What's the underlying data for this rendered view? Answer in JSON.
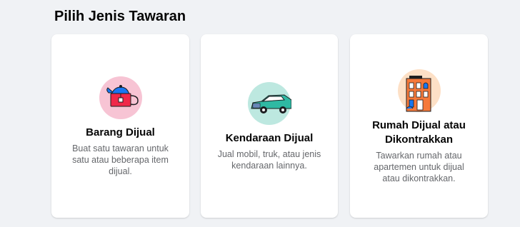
{
  "heading": "Pilih Jenis Tawaran",
  "cards": [
    {
      "title": "Barang Dijual",
      "description": "Buat satu tawaran untuk satu atau beberapa item dijual.",
      "icon": "kettle-icon"
    },
    {
      "title": "Kendaraan Dijual",
      "description": "Jual mobil, truk, atau jenis kendaraan lainnya.",
      "icon": "car-icon"
    },
    {
      "title": "Rumah Dijual atau Dikontrakkan",
      "description": "Tawarkan rumah atau apartemen untuk dijual atau dikontrakkan.",
      "icon": "house-icon"
    }
  ],
  "colors": {
    "background": "#f0f2f5",
    "card": "#ffffff",
    "title": "#050505",
    "secondary_text": "#65676b",
    "kettle_circle": "#f7c4d4",
    "car_circle": "#bde8e0",
    "house_circle": "#fde0c6"
  }
}
